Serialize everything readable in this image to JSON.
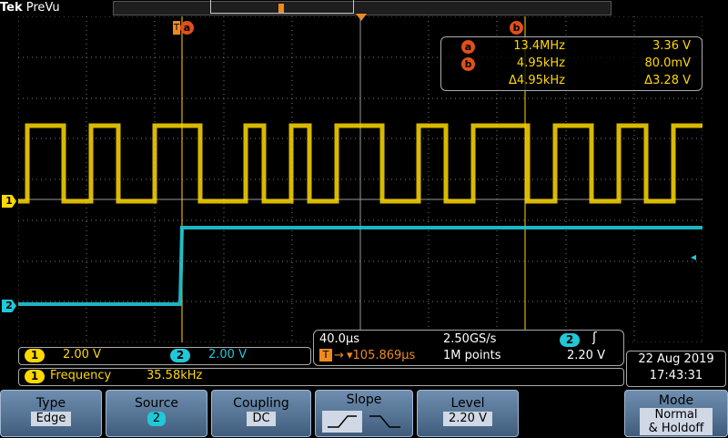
{
  "header": {
    "brand": "Tek",
    "mode": "PreVu"
  },
  "cursors": {
    "a_label": "a",
    "b_label": "b"
  },
  "measurements": {
    "row_a": {
      "tag": "a",
      "freq": "13.4MHz",
      "volt": "3.36 V"
    },
    "row_b": {
      "tag": "b",
      "freq": "4.95kHz",
      "volt": "80.0mV"
    },
    "row_delta": {
      "freq": "Δ4.95kHz",
      "volt": "Δ3.28 V"
    }
  },
  "channels": {
    "ch1": {
      "marker": "1",
      "scale": "2.00 V",
      "color": "#ffd800"
    },
    "ch2": {
      "marker": "2",
      "scale": "2.00 V",
      "color": "#20c8d8"
    }
  },
  "timebase": {
    "time_div": "40.0µs",
    "sample_rate": "2.50GS/s",
    "trigger_pos": "▾105.869µs",
    "record": "1M points",
    "trig_src": "2",
    "trig_slope": "ʃ",
    "trig_level": "2.20 V"
  },
  "measurement_bar": {
    "chan": "1",
    "label": "Frequency",
    "value": "35.58kHz"
  },
  "datetime": {
    "date": "22 Aug 2019",
    "time": "17:43:31"
  },
  "softkeys": {
    "type": {
      "label": "Type",
      "value": "Edge"
    },
    "source": {
      "label": "Source",
      "value": "2"
    },
    "coupling": {
      "label": "Coupling",
      "value": "DC"
    },
    "slope": {
      "label": "Slope"
    },
    "level": {
      "label": "Level",
      "value": "2.20 V"
    },
    "mode": {
      "label": "Mode",
      "value1": "Normal",
      "value2": "& Holdoff"
    }
  }
}
